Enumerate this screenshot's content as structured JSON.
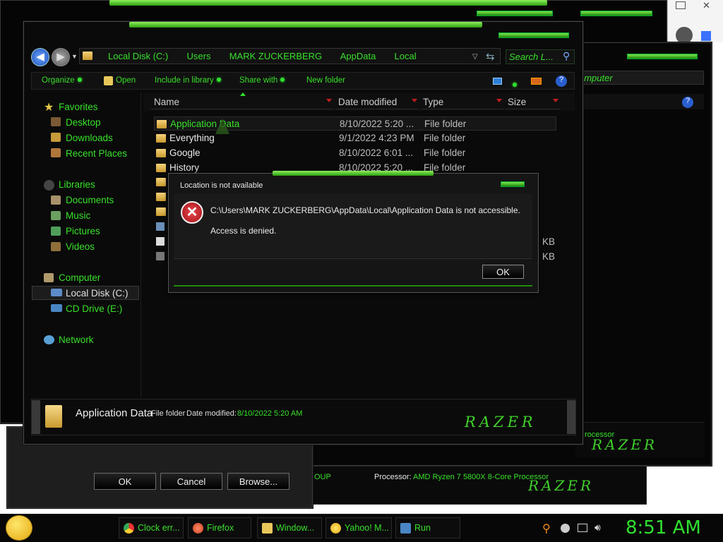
{
  "explorer": {
    "breadcrumb": [
      "Local Disk (C:)",
      "Users",
      "MARK ZUCKERBERG",
      "AppData",
      "Local"
    ],
    "search_placeholder": "Search L...",
    "toolbar": {
      "organize": "Organize",
      "open": "Open",
      "include": "Include in library",
      "share": "Share with",
      "new_folder": "New folder"
    },
    "sidebar": {
      "favorites": "Favorites",
      "desktop": "Desktop",
      "downloads": "Downloads",
      "recent": "Recent Places",
      "libraries": "Libraries",
      "documents": "Documents",
      "music": "Music",
      "pictures": "Pictures",
      "videos": "Videos",
      "computer": "Computer",
      "local_disk": "Local Disk (C:)",
      "cd_drive": "CD Drive (E:)",
      "network": "Network"
    },
    "columns": {
      "name": "Name",
      "date": "Date modified",
      "type": "Type",
      "size": "Size"
    },
    "files": [
      {
        "name": "Application Data",
        "date": "8/10/2022 5:20 ...",
        "type": "File folder"
      },
      {
        "name": "Everything",
        "date": "9/1/2022 4:23 PM",
        "type": "File folder"
      },
      {
        "name": "Google",
        "date": "8/10/2022 6:01 ...",
        "type": "File folder"
      },
      {
        "name": "History",
        "date": "8/10/2022 5:20 ...",
        "type": "File folder"
      }
    ],
    "size_kb1": "KB",
    "size_kb2": "KB",
    "details": {
      "name": "Application Data",
      "type": "File folder",
      "date_label": "Date modified:",
      "date_value": "8/10/2022 5:20 AM"
    },
    "brand": "RAZER"
  },
  "dialog": {
    "title": "Location is not available",
    "message": "C:\\Users\\MARK ZUCKERBERG\\AppData\\Local\\Application Data is not accessible.",
    "sub": "Access is denied.",
    "ok": "OK"
  },
  "back_window": {
    "breadcrumb_tail": "omputer",
    "processor_partial": "rocessor",
    "processor_label": "Processor:",
    "processor_value": "AMD Ryzen 7 5800X 8-Core Processor",
    "group_partial": "OUP",
    "brand": "RAZER"
  },
  "run_dialog": {
    "ok": "OK",
    "cancel": "Cancel",
    "browse": "Browse..."
  },
  "taskbar": {
    "items": [
      "Clock err...",
      "Firefox",
      "Window...",
      "Yahoo! M...",
      "Run"
    ],
    "clock": "8:51 AM"
  },
  "colors": {
    "accent": "#38e02a",
    "error": "#d4202a",
    "window_bg": "#0b0b0b"
  }
}
